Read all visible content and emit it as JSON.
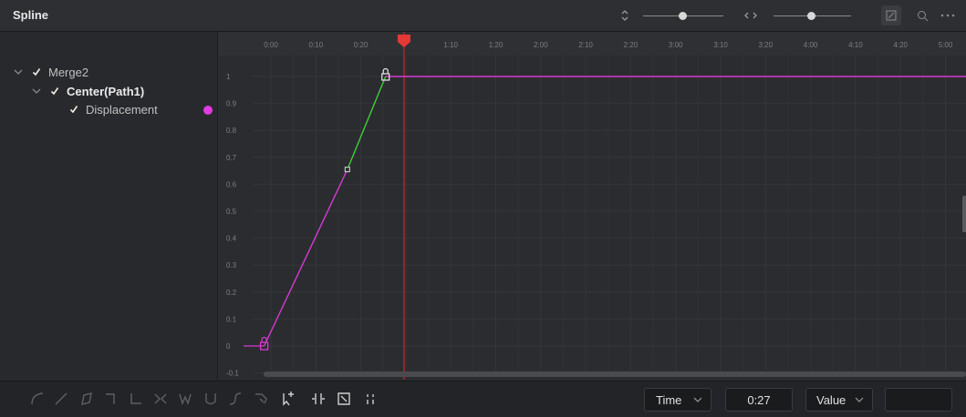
{
  "panel": {
    "title": "Spline"
  },
  "tree": {
    "items": [
      {
        "label": "Merge2",
        "checked": true,
        "expanded": true
      },
      {
        "label": "Center(Path1)",
        "checked": true,
        "expanded": true
      },
      {
        "label": "Displacement",
        "checked": true,
        "keyframe_color": "#e23be0"
      }
    ]
  },
  "timeline": {
    "ticks": [
      "0:00",
      "0:10",
      "0:20",
      "0:30",
      "1:10",
      "1:20",
      "2:00",
      "2:10",
      "2:20",
      "3:00",
      "3:10",
      "3:20",
      "4:00",
      "4:10",
      "4:20",
      "5:00"
    ],
    "playhead_label": "0:30"
  },
  "value_axis": {
    "ticks": [
      "1",
      "0.9",
      "0.8",
      "0.7",
      "0.6",
      "0.5",
      "0.4",
      "0.3",
      "0.2",
      "0.1",
      "0",
      "-0.1"
    ]
  },
  "curve": {
    "colors": {
      "selected": "#d63ad3",
      "active_segment": "#3fcf3a",
      "playhead": "#b3232a",
      "playhead_marker": "#e53935"
    }
  },
  "bottom": {
    "time_label": "Time",
    "current_time": "0:27",
    "value_label": "Value",
    "tools": [
      "smooth-icon",
      "linear-icon",
      "invert-icon",
      "step-in-icon",
      "step-out-icon",
      "reverse-icon",
      "time-stretch-icon",
      "shape-box-icon",
      "ease-in-out-icon",
      "select-tool-icon",
      "add-point-icon",
      "set-keyframe-icon",
      "zoom-fit-icon",
      "show-keyframes-icon"
    ]
  }
}
